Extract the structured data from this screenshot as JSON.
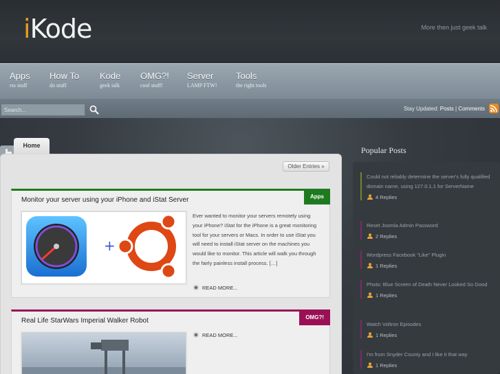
{
  "header": {
    "logo_i": "i",
    "logo_rest": "Kode",
    "tagline": "More then just geek talk"
  },
  "nav": [
    {
      "title": "Apps",
      "sub": "rss stuff"
    },
    {
      "title": "How To",
      "sub": "do stuff"
    },
    {
      "title": "Kode",
      "sub": "geek talk"
    },
    {
      "title": "OMG?!",
      "sub": "cool stuff!"
    },
    {
      "title": "Server",
      "sub": "LAMP FTW!"
    },
    {
      "title": "Tools",
      "sub": "the right tools"
    }
  ],
  "search": {
    "placeholder": "Search..."
  },
  "stay": {
    "prefix": "Stay Updated:",
    "posts": "Posts",
    "sep": " | ",
    "comments": "Comments"
  },
  "tabs": {
    "home": "Home"
  },
  "older_entries": "Older Entries »",
  "posts": [
    {
      "title": "Monitor your server using your iPhone and iStat Server",
      "category": "Apps",
      "category_color": "#1f7a1f",
      "excerpt": "Ever wanted to monitor your servers remotely using your iPhone? iStat for the iPhone is a great monitoring tool for your servers or Macs.  In order to use iStat you will need to install iStat server on the machines you would like to monitor.  This article will walk you through the fairly painless install process. […]",
      "read_more": "READ MORE..."
    },
    {
      "title": "Real Life StarWars Imperial Walker Robot",
      "category": "OMG?!",
      "category_color": "#9a1055",
      "read_more": "READ MORE..."
    }
  ],
  "sidebar": {
    "title": "Popular Posts",
    "items": [
      {
        "title": "Could not reliably determine the server's fully qualified domain name, using 127.0.1.1 for ServerName",
        "replies": "4 Replies"
      },
      {
        "title": "Reset Joomla Admin Password",
        "replies": "2 Replies"
      },
      {
        "title": "Wordpress Facebook \"Like\" Plugin",
        "replies": "1 Replies"
      },
      {
        "title": "Photo: Blue Screen of Death Never Looked So Good",
        "replies": "1 Replies"
      },
      {
        "title": "Watch Voltron Episodes",
        "replies": "1 Replies"
      },
      {
        "title": "I'm from Snyder County and I like it that way",
        "replies": "1 Replies"
      }
    ]
  },
  "colors": {
    "accent": "#e89a1c",
    "rss": "#e9891f",
    "apps": "#1f7a1f",
    "omg": "#9a1055"
  }
}
